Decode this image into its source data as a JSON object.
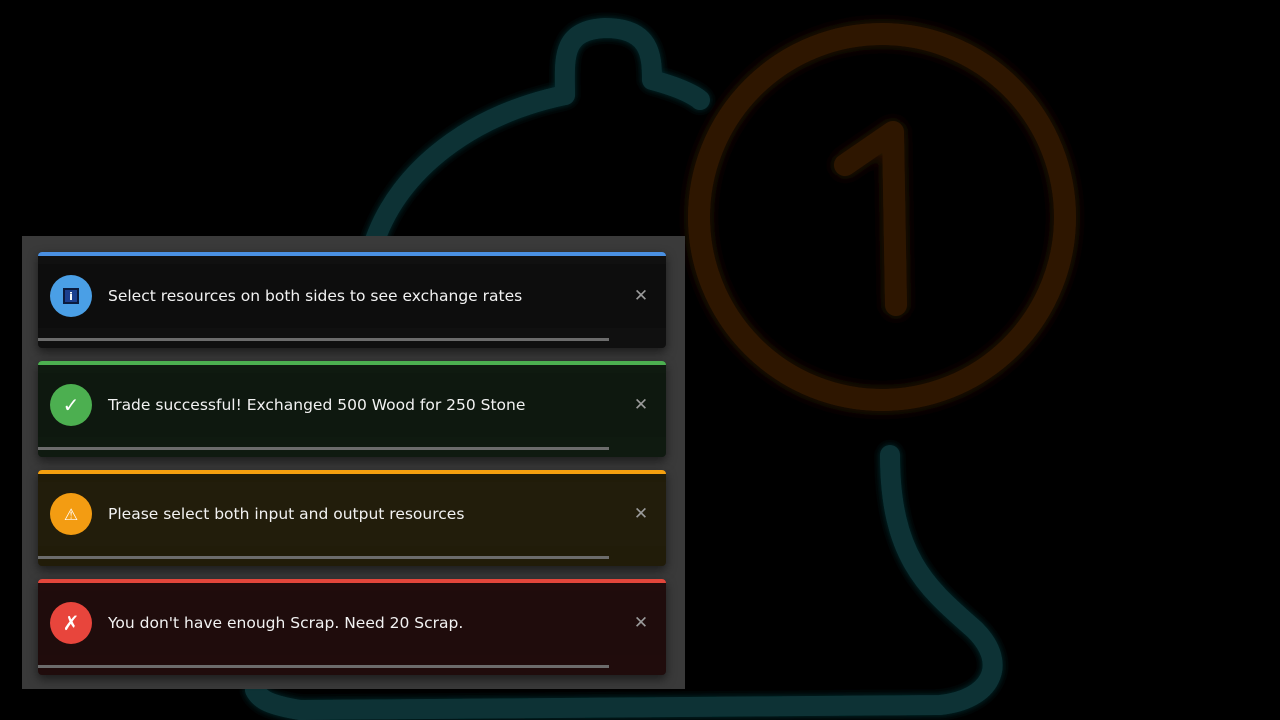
{
  "background": {
    "bell_icon": "bell-icon",
    "badge_icon": "badge-one-icon",
    "badge_text": "1"
  },
  "toasts": [
    {
      "type": "info",
      "icon": "info-icon",
      "icon_glyph": "i",
      "message": "Select resources on both sides to see exchange rates",
      "close_glyph": "✕",
      "progress": 0.91
    },
    {
      "type": "success",
      "icon": "checkmark-icon",
      "icon_glyph": "✓",
      "message": "Trade successful! Exchanged 500 Wood for 250 Stone",
      "close_glyph": "✕",
      "progress": 0.91
    },
    {
      "type": "warning",
      "icon": "warning-icon",
      "icon_glyph": "⚠",
      "message": "Please select both input and output resources",
      "close_glyph": "✕",
      "progress": 0.91
    },
    {
      "type": "error",
      "icon": "error-x-icon",
      "icon_glyph": "✗",
      "message": "You don't have enough Scrap. Need 20 Scrap.",
      "close_glyph": "✕",
      "progress": 0.91
    }
  ],
  "colors": {
    "info": "#4a90e2",
    "success": "#4caf50",
    "warning": "#f5a00f",
    "error": "#e2463b",
    "bell_glow": "#0f3a40",
    "badge_glow": "#3a1e08"
  }
}
